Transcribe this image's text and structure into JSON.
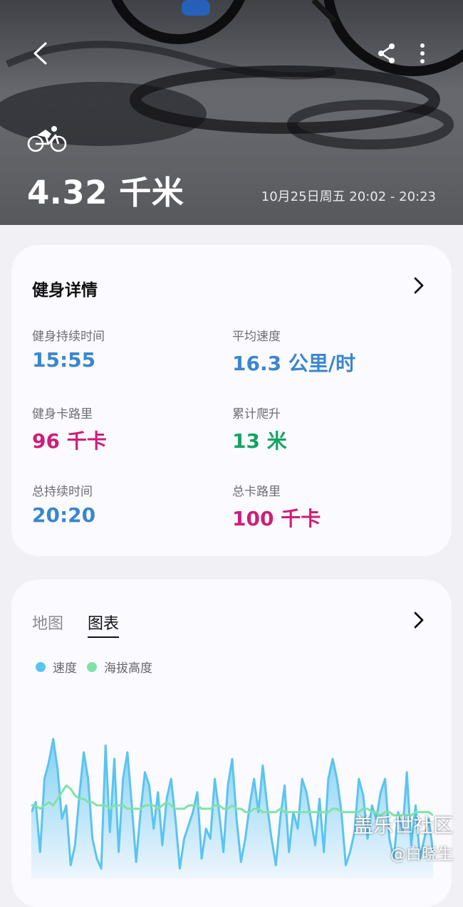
{
  "header": {
    "distance": "4.32 千米",
    "datetime": "10月25日周五 20:02 - 20:23",
    "icons": [
      "back-icon",
      "share-icon",
      "more-vertical-icon",
      "cycling-icon"
    ]
  },
  "details": {
    "title": "健身详情",
    "stats": [
      {
        "label": "健身持续时间",
        "value": "15:55",
        "color": "#3a86cf"
      },
      {
        "label": "平均速度",
        "value": "16.3 公里/时",
        "color": "#3a86cf"
      },
      {
        "label": "健身卡路里",
        "value": "96 千卡",
        "color": "#cc1f79"
      },
      {
        "label": "累计爬升",
        "value": "13 米",
        "color": "#16a463"
      },
      {
        "label": "总持续时间",
        "value": "20:20",
        "color": "#3a86cf"
      },
      {
        "label": "总卡路里",
        "value": "100 千卡",
        "color": "#cc1f79"
      }
    ]
  },
  "chart_card": {
    "tabs": [
      {
        "label": "地图",
        "active": false
      },
      {
        "label": "图表",
        "active": true
      }
    ],
    "legend": [
      {
        "label": "速度",
        "color": "#5ac4f0"
      },
      {
        "label": "海拔高度",
        "color": "#7fe3a8"
      }
    ]
  },
  "chart_data": {
    "type": "area",
    "title": "",
    "xlabel": "",
    "ylabel": "",
    "series": [
      {
        "name": "速度",
        "values": [
          20,
          23,
          8,
          30,
          35,
          42,
          33,
          18,
          22,
          4,
          10,
          25,
          38,
          30,
          12,
          6,
          3,
          40,
          14,
          36,
          8,
          30,
          38,
          22,
          5,
          20,
          32,
          28,
          15,
          26,
          10,
          24,
          30,
          18,
          3,
          12,
          16,
          20,
          26,
          6,
          15,
          12,
          30,
          20,
          8,
          28,
          36,
          18,
          5,
          12,
          22,
          30,
          20,
          34,
          22,
          12,
          4,
          18,
          28,
          8,
          20,
          15,
          30,
          26,
          18,
          10,
          24,
          8,
          30,
          36,
          30,
          20,
          4,
          8,
          14,
          30,
          25,
          12,
          22,
          18,
          26,
          30,
          12,
          6,
          20,
          14,
          32,
          10,
          22,
          6,
          12,
          18,
          8
        ]
      },
      {
        "name": "海拔高度",
        "values": [
          22,
          22,
          21,
          22,
          23,
          22,
          24,
          26,
          28,
          27,
          25,
          24,
          24,
          23,
          23,
          22,
          22,
          22,
          21,
          22,
          22,
          22,
          21,
          21,
          21,
          21,
          22,
          22,
          22,
          21,
          22,
          23,
          22,
          21,
          21,
          21,
          22,
          22,
          22,
          21,
          21,
          21,
          22,
          22,
          21,
          21,
          22,
          21,
          21,
          20,
          20,
          21,
          21,
          20,
          20,
          20,
          20,
          21,
          20,
          20,
          20,
          20,
          20,
          20,
          20,
          20,
          20,
          20,
          20,
          21,
          21,
          20,
          20,
          20,
          20,
          20,
          21,
          21,
          20,
          20,
          19,
          20,
          20,
          19,
          19,
          19,
          19,
          19,
          20,
          20,
          20,
          20,
          19
        ]
      }
    ],
    "ylim": [
      0,
      45
    ],
    "grid": false
  },
  "watermark": {
    "line1": "盖乐世社区",
    "line2": "@白晓生"
  }
}
